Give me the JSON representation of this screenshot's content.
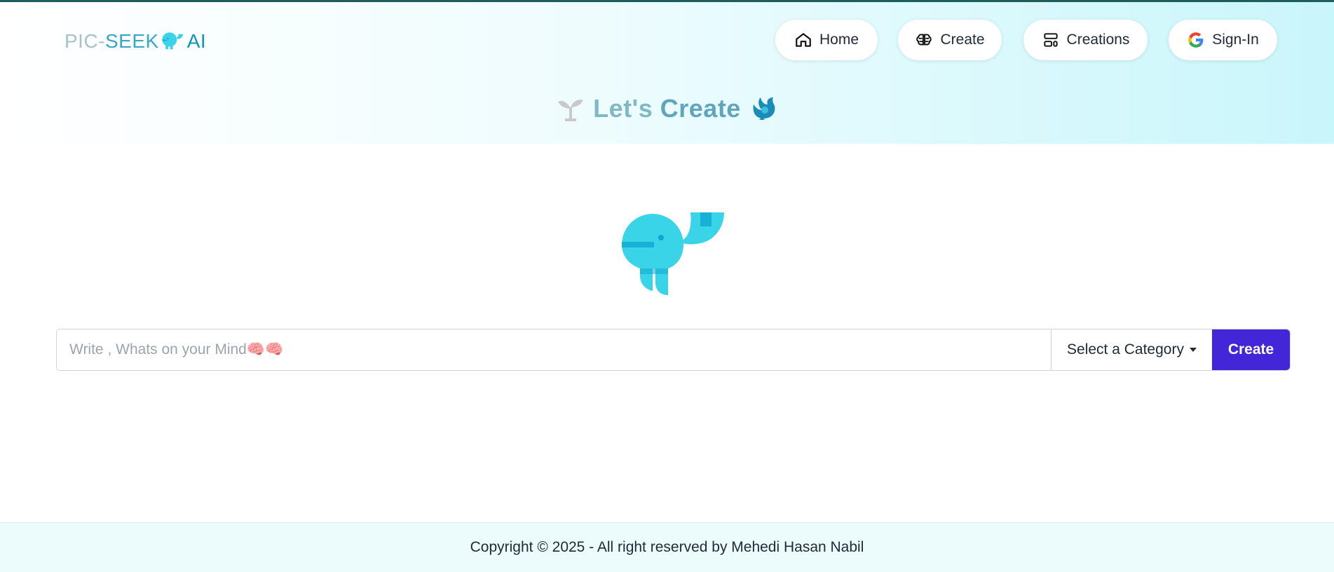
{
  "brand": {
    "part1": "PIC-",
    "part2": "SEEK",
    "part3": "AI",
    "mascot_icon": "whale-icon"
  },
  "nav": [
    {
      "label": "Home",
      "icon": "home-icon"
    },
    {
      "label": "Create",
      "icon": "brain-icon"
    },
    {
      "label": "Creations",
      "icon": "layout-icon"
    },
    {
      "label": "Sign-In",
      "icon": "google-icon"
    }
  ],
  "page_title": {
    "part1": "Let's",
    "part2": "Create",
    "left_icon": "sprout-icon",
    "right_icon": "bird-icon"
  },
  "search": {
    "value": "",
    "placeholder": "Write , Whats on your Mind🧠🧠"
  },
  "category": {
    "selected": "Select a Category"
  },
  "create_button": {
    "label": "Create"
  },
  "footer": {
    "text": "Copyright © 2025 - All right reserved by Mehedi Hasan Nabil"
  },
  "colors": {
    "accent": "#4326d8",
    "whale": "#39d4e8",
    "whale_dark": "#0ea5cf",
    "border_top": "#1f5c5c"
  }
}
